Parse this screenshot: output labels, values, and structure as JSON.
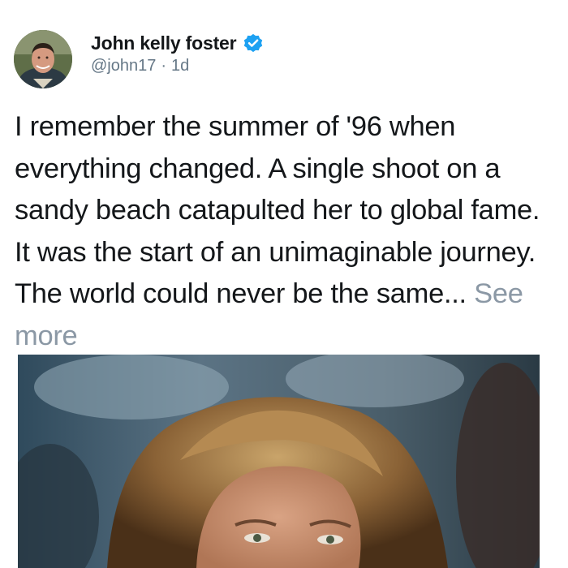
{
  "tweet": {
    "display_name": "John kelly foster",
    "handle": "@john17",
    "separator": "·",
    "time": "1d",
    "text": "I remember the summer of '96 when everything changed. A single shoot on a sandy beach catapulted her to global fame. It was the start of an unimaginable journey. The world could never be the same...",
    "see_more_label": "See more"
  },
  "icons": {
    "verified": "verified-badge-icon",
    "avatar": "profile-photo",
    "media": "photo-woman-portrait"
  },
  "colors": {
    "text": "#14171a",
    "muted": "#657786",
    "see_more": "#8b98a5",
    "verified_blue": "#1da1f2"
  }
}
